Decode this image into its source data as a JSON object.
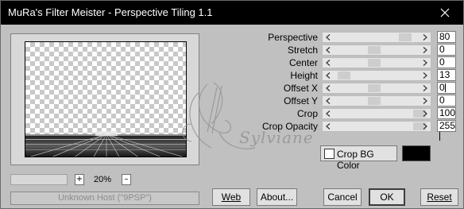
{
  "window": {
    "title": "MuRa's Filter Meister - Perspective Tiling 1.1",
    "close_icon": "close-icon"
  },
  "preview": {
    "zoom_plus": "+",
    "zoom_value": "20%",
    "zoom_minus": "–"
  },
  "status": {
    "text": "Unknown Host (\"9PSP\")"
  },
  "parameters": [
    {
      "label": "Perspective",
      "value": "80"
    },
    {
      "label": "Stretch",
      "value": "0"
    },
    {
      "label": "Center",
      "value": "0"
    },
    {
      "label": "Height",
      "value": "13"
    },
    {
      "label": "Offset X",
      "value": "0"
    },
    {
      "label": "Offset Y",
      "value": "0"
    },
    {
      "label": "Crop",
      "value": "100"
    },
    {
      "label": "Crop Opacity",
      "value": "255"
    }
  ],
  "crop_bg": {
    "label": "Crop BG Color",
    "checked": false,
    "color": "#000000"
  },
  "buttons": {
    "web": "Web",
    "about": "About...",
    "cancel": "Cancel",
    "ok": "OK",
    "reset": "Reset"
  },
  "watermark": {
    "text": "Sylviane"
  }
}
